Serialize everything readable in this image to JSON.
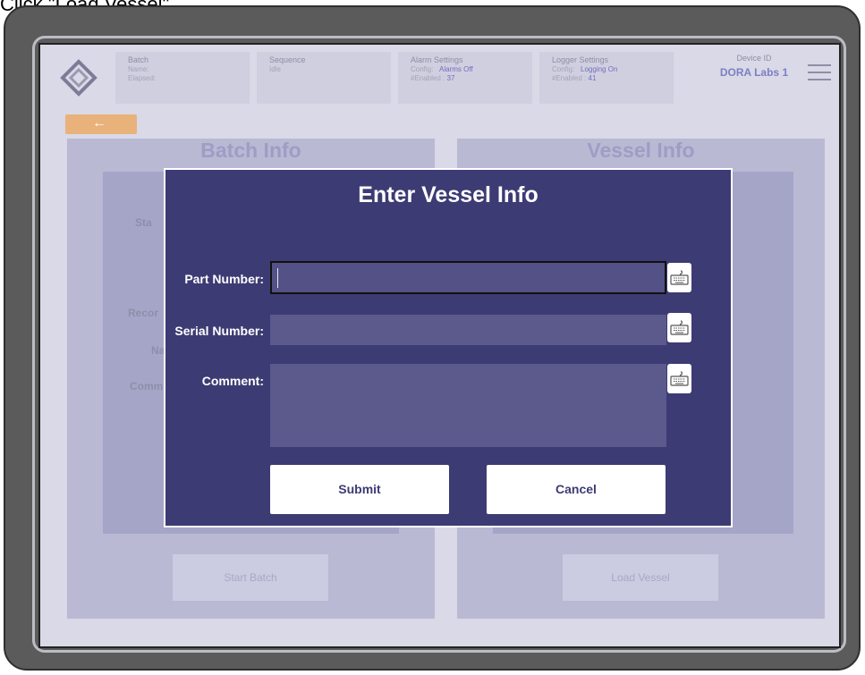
{
  "instruction": "Click \"Load Vessel\"",
  "header": {
    "batch": {
      "title": "Batch",
      "name_label": "Name:",
      "elapsed_label": "Elapsed:"
    },
    "sequence": {
      "title": "Sequence",
      "value": "Idle"
    },
    "alarm_settings": {
      "title": "Alarm Settings",
      "config_label": "Config:",
      "config_value": "Alarms Off",
      "enabled_label": "#Enabled :",
      "enabled_value": "37"
    },
    "logger_settings": {
      "title": "Logger Settings",
      "config_label": "Config:",
      "config_value": "Logging On",
      "enabled_label": "#Enabled :",
      "enabled_value": "41"
    },
    "device": {
      "label": "Device ID",
      "value": "DORA Labs 1"
    }
  },
  "back_arrow": "←",
  "batch_panel": {
    "title": "Batch Info",
    "labels": [
      "Sta",
      "Recor",
      "Na",
      "Comm"
    ],
    "start_button": "Start Batch"
  },
  "vessel_panel": {
    "title": "Vessel Info",
    "load_button": "Load Vessel"
  },
  "modal": {
    "title": "Enter Vessel Info",
    "part_number_label": "Part Number:",
    "part_number_value": "",
    "serial_number_label": "Serial Number:",
    "serial_number_value": "",
    "comment_label": "Comment:",
    "comment_value": "",
    "submit": "Submit",
    "cancel": "Cancel"
  },
  "colors": {
    "modal_bg": "#3d3b73",
    "screen_bg": "#d9d9e7",
    "back_button": "#e8b27a"
  },
  "icons": [
    "logo-icon",
    "hamburger-menu-icon",
    "keyboard-icon"
  ]
}
